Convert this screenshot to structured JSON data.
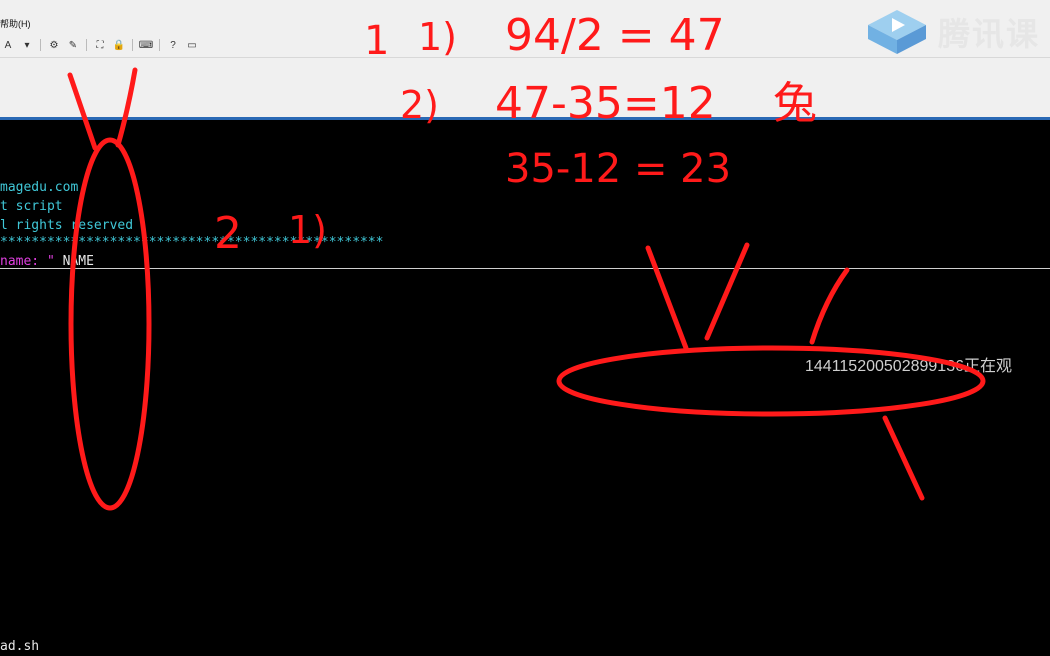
{
  "app": {
    "menu_label": "帮助(H)",
    "toolbar_text_tool": "A"
  },
  "terminal": {
    "lines": [
      {
        "text": "magedu.com",
        "color": "cyan"
      },
      {
        "text": "t script",
        "color": "cyan"
      },
      {
        "text": "l rights reserved",
        "color": "cyan"
      },
      {
        "text": "*************************************************",
        "color": "cyan"
      }
    ],
    "prompt_label": "name: \"",
    "prompt_value": " NAME",
    "bottom_line": "ad.sh"
  },
  "overlay": {
    "watermark": "腾讯课",
    "viewer_notice": "144115200502899136正在观"
  },
  "annotations": {
    "n1": "1",
    "n1_sub": "1)",
    "eq1": "94/2 = 47",
    "n2_sub": "2)",
    "eq2": "47-35=12",
    "rabbit": "兔",
    "eq3": "35-12 = 23",
    "n2": "2",
    "n2b": "1)"
  },
  "colors": {
    "ink": "#ff1a1a",
    "terminal_cyan": "#40c8d8",
    "terminal_magenta": "#e040e0",
    "accent_blue": "#2a69b5"
  }
}
